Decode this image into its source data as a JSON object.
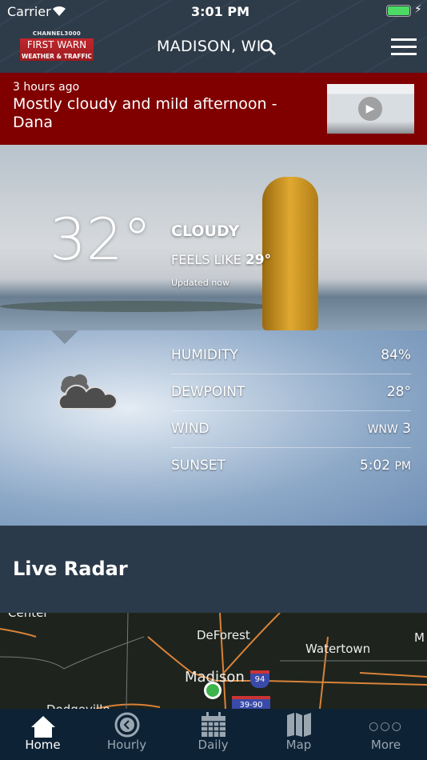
{
  "status_bar": {
    "carrier": "Carrier",
    "time": "3:01 PM",
    "battery_color": "#4cd964"
  },
  "header": {
    "logo": {
      "channel": "CHANNEL3000",
      "line1": "FIRST WARN",
      "line2": "WEATHER & TRAFFIC"
    },
    "location": "MADISON, WI"
  },
  "banner": {
    "age": "3 hours ago",
    "headline": "Mostly cloudy and mild afternoon -Dana"
  },
  "current": {
    "temperature": "32°",
    "condition": "CLOUDY",
    "feels_like_label": "FEELS LIKE",
    "feels_like": "29°",
    "updated": "Updated now",
    "icon": "cloudy-icon"
  },
  "details": [
    {
      "label": "HUMIDITY",
      "value": "84%"
    },
    {
      "label": "DEWPOINT",
      "value": "28°"
    },
    {
      "label": "WIND",
      "value": "WNW",
      "value_strong": "3"
    },
    {
      "label": "SUNSET",
      "value": "5:02",
      "suffix": "PM"
    }
  ],
  "radar": {
    "title": "Live Radar",
    "places": [
      "Center",
      "DeForest",
      "Watertown",
      "Madison",
      "Dodgeville",
      "M"
    ],
    "shields": [
      "94",
      "39-90"
    ]
  },
  "tabs": [
    {
      "label": "Home",
      "active": true
    },
    {
      "label": "Hourly"
    },
    {
      "label": "Daily"
    },
    {
      "label": "Map"
    },
    {
      "label": "More"
    }
  ]
}
